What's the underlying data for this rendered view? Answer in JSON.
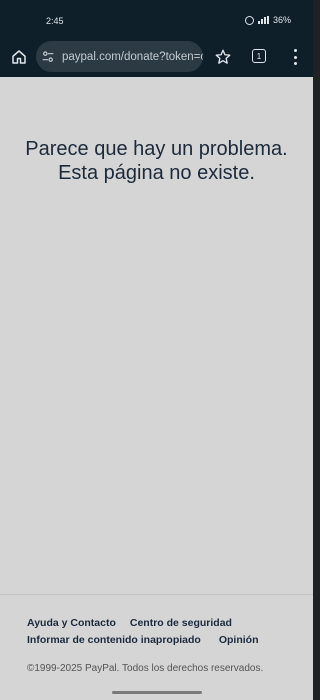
{
  "status_bar": {
    "time": "2:45",
    "battery": "36%",
    "icons": [
      "alarm-icon",
      "signal-icon",
      "battery-icon"
    ]
  },
  "browser": {
    "url": "paypal.com/donate?token=c",
    "tab_count": "1",
    "icons": [
      "home-icon",
      "tune-icon",
      "star-icon",
      "tabs-icon",
      "more-vert-icon"
    ]
  },
  "page": {
    "error_line1": "Parece que hay un problema.",
    "error_line2": "Esta página no existe."
  },
  "footer": {
    "links": [
      "Ayuda y Contacto",
      "Centro de seguridad",
      "Informar de contenido inapropiado",
      "Opinión"
    ],
    "copyright": "©1999-2025 PayPal. Todos los derechos reservados."
  },
  "colors": {
    "browser_chrome": "#0f1f29",
    "url_box": "#2b3a43",
    "page_background": "#d5d5d5",
    "text_dark": "#1c2a3b"
  }
}
